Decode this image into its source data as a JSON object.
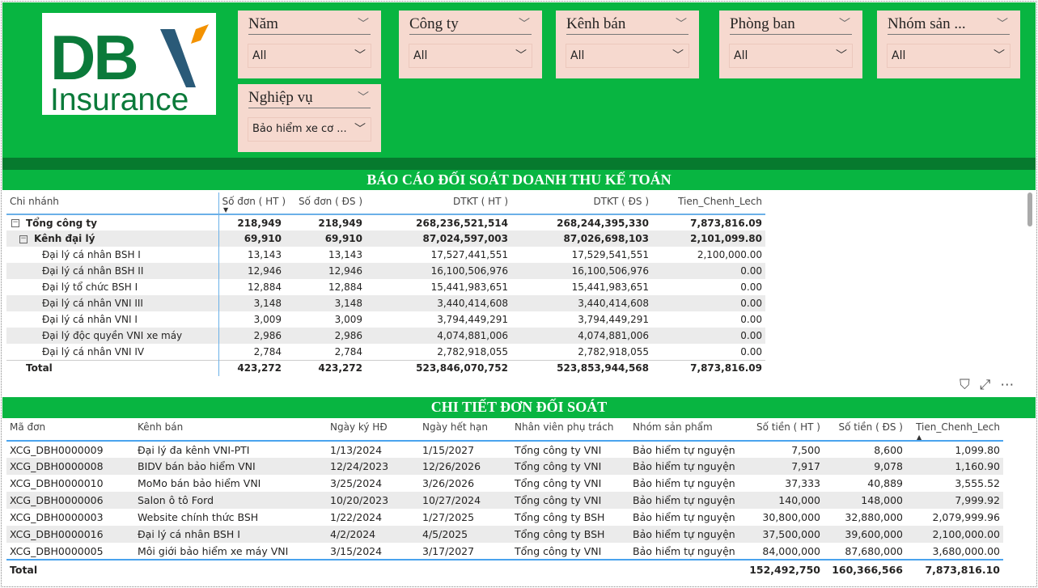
{
  "logo": {
    "brand": "DBV",
    "sub": "Insurance",
    "colors": {
      "green": "#0b7a3a",
      "blue": "#2a5a78",
      "orange": "#f39200"
    }
  },
  "slicers": [
    {
      "label": "Năm",
      "value": "All"
    },
    {
      "label": "Công ty",
      "value": "All"
    },
    {
      "label": "Kênh bán",
      "value": "All"
    },
    {
      "label": "Phòng ban",
      "value": "All"
    },
    {
      "label": "Nhóm sản ...",
      "value": "All"
    },
    {
      "label": "Nghiệp vụ",
      "value": "Bảo hiểm xe cơ ..."
    }
  ],
  "report": {
    "title": "BÁO CÁO ĐỐI SOÁT DOANH THU KẾ TOÁN",
    "columns": [
      "Chi nhánh",
      "Số đơn ( HT )",
      "Số đơn ( ĐS )",
      "DTKT ( HT )",
      "DTKT ( ĐS )",
      "Tien_Chenh_Lech"
    ],
    "rows": [
      {
        "name": "Tổng công ty",
        "values": [
          "218,949",
          "218,949",
          "268,236,521,514",
          "268,244,395,330",
          "7,873,816.09"
        ]
      },
      {
        "name": "Kênh đại lý",
        "values": [
          "69,910",
          "69,910",
          "87,024,597,003",
          "87,026,698,103",
          "2,101,099.80"
        ]
      },
      {
        "name": "Đại lý cá nhân BSH I",
        "values": [
          "13,143",
          "13,143",
          "17,527,441,551",
          "17,529,541,551",
          "2,100,000.00"
        ]
      },
      {
        "name": "Đại lý cá nhân BSH II",
        "values": [
          "12,946",
          "12,946",
          "16,100,506,976",
          "16,100,506,976",
          "0.00"
        ]
      },
      {
        "name": "Đại lý tổ chức BSH I",
        "values": [
          "12,884",
          "12,884",
          "15,441,983,651",
          "15,441,983,651",
          "0.00"
        ]
      },
      {
        "name": "Đại lý cá nhân VNI III",
        "values": [
          "3,148",
          "3,148",
          "3,440,414,608",
          "3,440,414,608",
          "0.00"
        ]
      },
      {
        "name": "Đại lý cá nhân VNI I",
        "values": [
          "3,009",
          "3,009",
          "3,794,449,291",
          "3,794,449,291",
          "0.00"
        ]
      },
      {
        "name": "Đại lý độc quyền VNI xe máy",
        "values": [
          "2,986",
          "2,986",
          "4,074,881,006",
          "4,074,881,006",
          "0.00"
        ]
      },
      {
        "name": "Đại lý cá nhân VNI IV",
        "values": [
          "2,784",
          "2,784",
          "2,782,918,055",
          "2,782,918,055",
          "0.00"
        ]
      }
    ],
    "total": {
      "name": "Total",
      "values": [
        "423,272",
        "423,272",
        "523,846,070,752",
        "523,853,944,568",
        "7,873,816.09"
      ]
    }
  },
  "detail": {
    "title": "CHI TIẾT ĐƠN ĐỐI SOÁT",
    "columns": [
      "Mã đơn",
      "Kênh bán",
      "Ngày ký HĐ",
      "Ngày hết hạn",
      "Nhân viên phụ trách",
      "Nhóm sản phẩm",
      "Số tiền ( HT )",
      "Số tiền ( ĐS )",
      "Tien_Chenh_Lech"
    ],
    "rows": [
      [
        "XCG_DBH0000009",
        "Đại lý đa kênh VNI-PTI",
        "1/13/2024",
        "1/15/2027",
        "Tổng công ty VNI",
        "Bảo hiểm tự nguyện",
        "7,500",
        "8,600",
        "1,099.80"
      ],
      [
        "XCG_DBH0000008",
        "BIDV bán bảo hiểm VNI",
        "12/24/2023",
        "12/26/2026",
        "Tổng công ty VNI",
        "Bảo hiểm tự nguyện",
        "7,917",
        "9,078",
        "1,160.90"
      ],
      [
        "XCG_DBH0000010",
        "MoMo bán bảo hiểm VNI",
        "3/25/2024",
        "3/26/2026",
        "Tổng công ty VNI",
        "Bảo hiểm tự nguyện",
        "37,333",
        "40,889",
        "3,555.52"
      ],
      [
        "XCG_DBH0000006",
        "Salon ô tô Ford",
        "10/20/2023",
        "10/27/2024",
        "Tổng công ty VNI",
        "Bảo hiểm tự nguyện",
        "140,000",
        "148,000",
        "7,999.92"
      ],
      [
        "XCG_DBH0000003",
        "Website chính thức BSH",
        "1/22/2024",
        "1/27/2025",
        "Tổng công ty BSH",
        "Bảo hiểm tự nguyện",
        "30,800,000",
        "32,880,000",
        "2,079,999.96"
      ],
      [
        "XCG_DBH0000016",
        "Đại lý cá nhân BSH I",
        "4/2/2024",
        "4/5/2025",
        "Tổng công ty BSH",
        "Bảo hiểm tự nguyện",
        "37,500,000",
        "39,600,000",
        "2,100,000.00"
      ],
      [
        "XCG_DBH0000005",
        "Môi giới bảo hiểm xe máy VNI",
        "3/15/2024",
        "3/17/2027",
        "Tổng công ty VNI",
        "Bảo hiểm tự nguyện",
        "84,000,000",
        "87,680,000",
        "3,680,000.00"
      ]
    ],
    "total": {
      "label": "Total",
      "values": [
        "152,492,750",
        "160,366,566",
        "7,873,816.10"
      ]
    }
  }
}
